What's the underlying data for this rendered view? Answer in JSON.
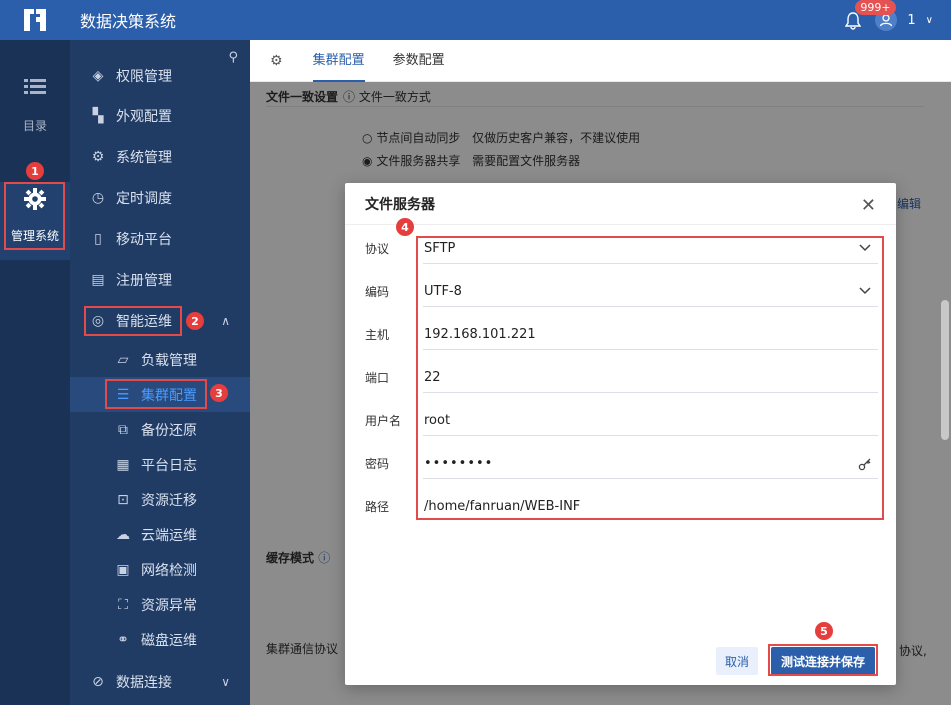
{
  "app": {
    "title": "数据决策系统",
    "badge_count": "999+",
    "user": "1"
  },
  "rail": [
    {
      "label": "目录",
      "icon": "list-icon"
    },
    {
      "label": "管理系统",
      "icon": "gear-icon"
    }
  ],
  "sidebar": {
    "items": [
      {
        "label": "权限管理",
        "icon": "shield-icon"
      },
      {
        "label": "外观配置",
        "icon": "brush-icon"
      },
      {
        "label": "系统管理",
        "icon": "gear-icon"
      },
      {
        "label": "定时调度",
        "icon": "timer-icon"
      },
      {
        "label": "移动平台",
        "icon": "mobile-icon"
      },
      {
        "label": "注册管理",
        "icon": "register-icon"
      },
      {
        "label": "智能运维",
        "icon": "ops-icon"
      },
      {
        "label": "数据连接",
        "icon": "link-icon"
      }
    ],
    "sub_items": [
      {
        "label": "负载管理",
        "icon": "load-icon"
      },
      {
        "label": "集群配置",
        "icon": "cluster-icon"
      },
      {
        "label": "备份还原",
        "icon": "backup-icon"
      },
      {
        "label": "平台日志",
        "icon": "log-icon"
      },
      {
        "label": "资源迁移",
        "icon": "migrate-icon"
      },
      {
        "label": "云端运维",
        "icon": "cloud-icon"
      },
      {
        "label": "网络检测",
        "icon": "network-icon"
      },
      {
        "label": "资源异常",
        "icon": "exception-icon"
      },
      {
        "label": "磁盘运维",
        "icon": "disk-icon"
      }
    ]
  },
  "main": {
    "tabs": [
      "集群配置",
      "参数配置"
    ],
    "section_title": "文件一致设置",
    "section_hint": "文件一致方式",
    "option1": "节点间自动同步",
    "option1_note": "仅做历史客户兼容，不建议使用",
    "option2": "文件服务器共享",
    "option2_note": "需要配置文件服务器",
    "edit_link": "编辑",
    "cache_mode": "缓存模式",
    "cluster_protocol": "集群通信协议",
    "protocol_note": "协议,"
  },
  "dialog": {
    "title": "文件服务器",
    "fields": [
      {
        "label": "协议",
        "value": "SFTP"
      },
      {
        "label": "编码",
        "value": "UTF-8"
      },
      {
        "label": "主机",
        "value": "192.168.101.221"
      },
      {
        "label": "端口",
        "value": "22"
      },
      {
        "label": "用户名",
        "value": "root"
      },
      {
        "label": "密码",
        "value": "••••••••"
      },
      {
        "label": "路径",
        "value": "/home/fanruan/WEB-INF"
      }
    ],
    "cancel_label": "取消",
    "ok_label": "测试连接并保存"
  },
  "annotations": [
    "1",
    "2",
    "3",
    "4",
    "5"
  ],
  "colors": {
    "primary": "#2b5fab",
    "annotation": "#e34b4b",
    "sidebar": "#203b64",
    "rail": "#1a3256"
  }
}
